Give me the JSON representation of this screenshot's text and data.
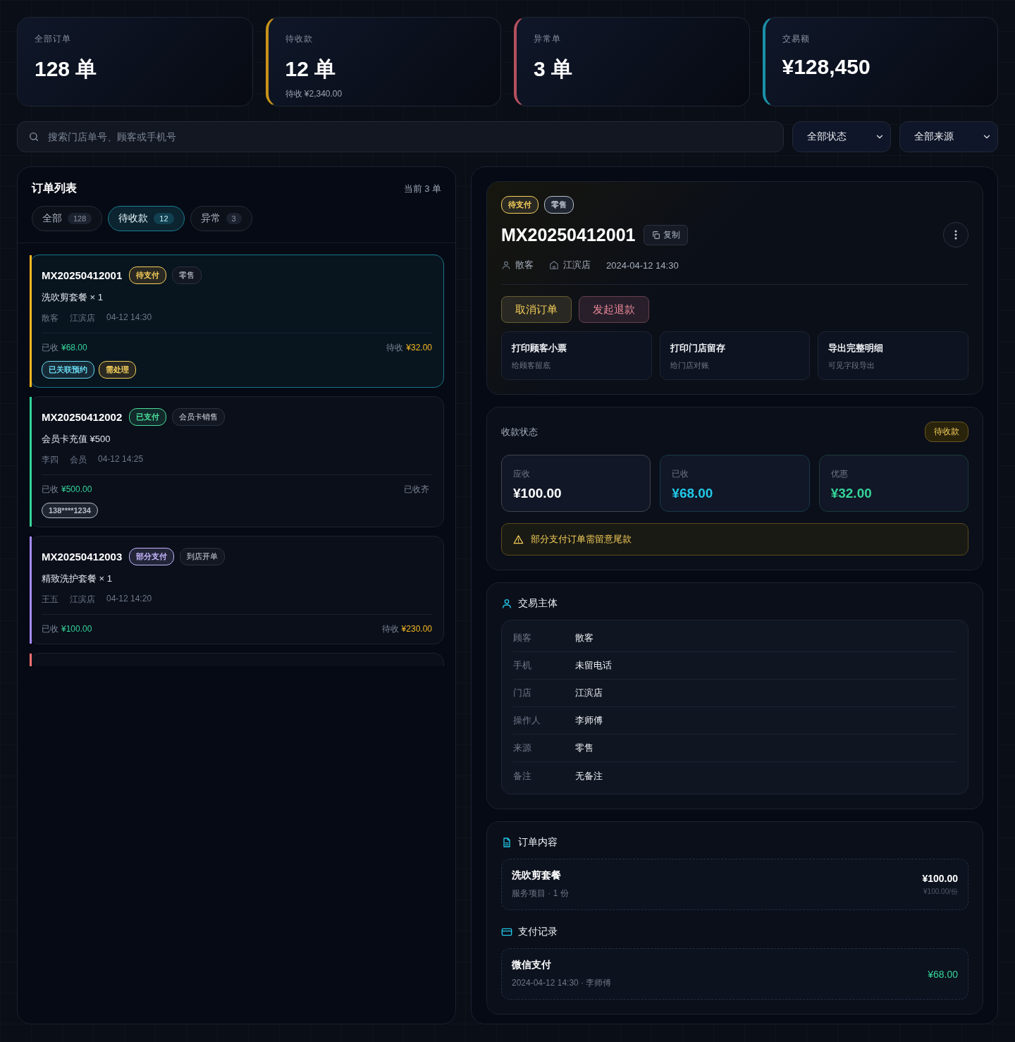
{
  "stats": [
    {
      "label": "全部订单",
      "value": "128 单"
    },
    {
      "label": "待收款",
      "value": "12 单",
      "sub": "待收 ¥2,340.00",
      "color": "#c8921a"
    },
    {
      "label": "异常单",
      "value": "3 单",
      "color": "#b4505e"
    },
    {
      "label": "交易额",
      "value": "¥128,450",
      "color": "#1a90a8"
    }
  ],
  "search": {
    "placeholder": "搜索门店单号、顾客或手机号"
  },
  "filters": [
    "全部状态",
    "全部来源"
  ],
  "order_list": {
    "title": "订单列表",
    "count": "当前 3 单",
    "tabs": [
      {
        "label": "全部",
        "count": "128",
        "selected": false
      },
      {
        "label": "待收款",
        "count": "12",
        "selected": true
      },
      {
        "label": "异常",
        "count": "3",
        "selected": false
      }
    ],
    "orders": [
      {
        "id": "MX20250412001",
        "status": {
          "label": "待支付",
          "color": "#f5cf5a"
        },
        "source": "零售",
        "item": "洗吹剪套餐 × 1",
        "customer": "散客",
        "store": "江滨店",
        "time": "04-12 14:30",
        "paid_label": "已收",
        "paid": "¥68.00",
        "due_label": "待收",
        "due": "¥32.00",
        "tags": [
          {
            "label": "已关联预约",
            "color": "#67d8f0"
          },
          {
            "label": "需处理",
            "color": "#f5cf5a"
          }
        ],
        "color": "#f5b820",
        "selected": true
      },
      {
        "id": "MX20250412002",
        "status": {
          "label": "已支付",
          "color": "#4ade9a"
        },
        "source": "会员卡销售",
        "item": "会员卡充值 ¥500",
        "customer": "李四",
        "store": "会员",
        "time": "04-12 14:25",
        "paid_label": "已收",
        "paid": "¥500.00",
        "settled": "已收齐",
        "tags": [
          {
            "label": "138****1234",
            "color": "#b7bec9"
          }
        ],
        "color": "#34d399",
        "selected": false
      },
      {
        "id": "MX20250412003",
        "status": {
          "label": "部分支付",
          "color": "#c4b5fd"
        },
        "source": "到店开单",
        "item": "精致洗护套餐 × 1",
        "customer": "王五",
        "store": "江滨店",
        "time": "04-12 14:20",
        "paid_label": "已收",
        "paid": "¥100.00",
        "due_label": "待收",
        "due": "¥230.00",
        "color": "#a78bfa",
        "selected": false
      },
      {
        "color": "#f87171",
        "selected": false
      }
    ]
  },
  "detail": {
    "badges": [
      {
        "label": "待支付",
        "color": "#f5cf5a"
      },
      {
        "label": "零售",
        "color": "#b7bec9"
      }
    ],
    "id": "MX20250412001",
    "copy": "复制",
    "customer": "散客",
    "store": "江滨店",
    "time": "2024-04-12 14:30",
    "actions": [
      {
        "label": "取消订单",
        "color": "#f5cf5a"
      },
      {
        "label": "发起退款",
        "color": "#f08a9a"
      }
    ],
    "prints": [
      {
        "title": "打印顾客小票",
        "sub": "给顾客留底"
      },
      {
        "title": "打印门店留存",
        "sub": "给门店对账"
      },
      {
        "title": "导出完整明细",
        "sub": "可见字段导出"
      }
    ],
    "payment": {
      "title": "收款状态",
      "badge": "待收款",
      "amounts": [
        {
          "label": "应收",
          "value": "¥100.00",
          "color": "#ffffff"
        },
        {
          "label": "已收",
          "value": "¥68.00",
          "color": "#22c7e8"
        },
        {
          "label": "优惠",
          "value": "¥32.00",
          "color": "#34d399"
        }
      ],
      "warning": "部分支付订单需留意尾款"
    },
    "subject": {
      "title": "交易主体",
      "rows": [
        {
          "label": "顾客",
          "value": "散客"
        },
        {
          "label": "手机",
          "value": "未留电话"
        },
        {
          "label": "门店",
          "value": "江滨店"
        },
        {
          "label": "操作人",
          "value": "李师傅"
        },
        {
          "label": "来源",
          "value": "零售"
        },
        {
          "label": "备注",
          "value": "无备注"
        }
      ]
    },
    "content": {
      "title": "订单内容",
      "items": [
        {
          "name": "洗吹剪套餐",
          "sub": "服务项目 · 1 份",
          "price": "¥100.00",
          "unit": "¥100.00/份"
        }
      ]
    },
    "payments": {
      "title": "支付记录",
      "records": [
        {
          "method": "微信支付",
          "sub": "2024-04-12 14:30 · 李师傅",
          "amount": "¥68.00"
        }
      ]
    }
  }
}
